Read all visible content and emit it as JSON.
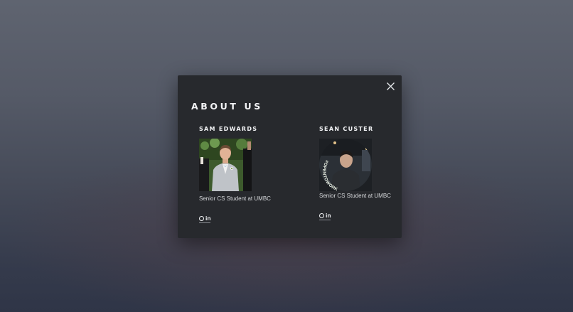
{
  "modal": {
    "title": "ABOUT US",
    "close_icon": "close-icon"
  },
  "members": [
    {
      "name": "SAM EDWARDS",
      "role": "Senior CS Student at UMBC",
      "photo": "profile-photo",
      "links": [
        "github-icon",
        "linkedin-icon"
      ],
      "linkedin_text": "in"
    },
    {
      "name": "SEAN CUSTER",
      "role": "Senior CS Student at UMBC",
      "photo": "profile-photo-opentowork",
      "photo_frame_text": "#OPENTOWORK",
      "links": [
        "github-icon",
        "linkedin-icon"
      ],
      "linkedin_text": "in"
    }
  ],
  "colors": {
    "modal_bg": "#27292d",
    "text": "#e7e9ec",
    "opentowork_green": "#4f7d46"
  }
}
